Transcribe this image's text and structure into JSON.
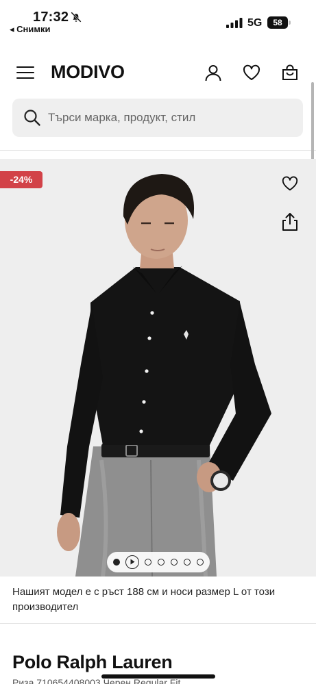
{
  "status_bar": {
    "time": "17:32",
    "back_app": "◂ Снимки",
    "network": "5G",
    "battery": "58"
  },
  "header": {
    "logo": "MODIVO"
  },
  "search": {
    "placeholder": "Търси марка, продукт, стил"
  },
  "product": {
    "discount_badge": "-24%",
    "gallery_page": "2",
    "gallery_count": "7",
    "model_caption": "Нашият модел е с ръст 188 см и носи размер L от този производител",
    "brand": "Polo Ralph Lauren",
    "model_line": "Риза 710654408003 Черен Regular Fit"
  },
  "colors": {
    "discount": "#d24248",
    "hero_bg": "#eeeeee",
    "search_bg": "#efefef"
  }
}
